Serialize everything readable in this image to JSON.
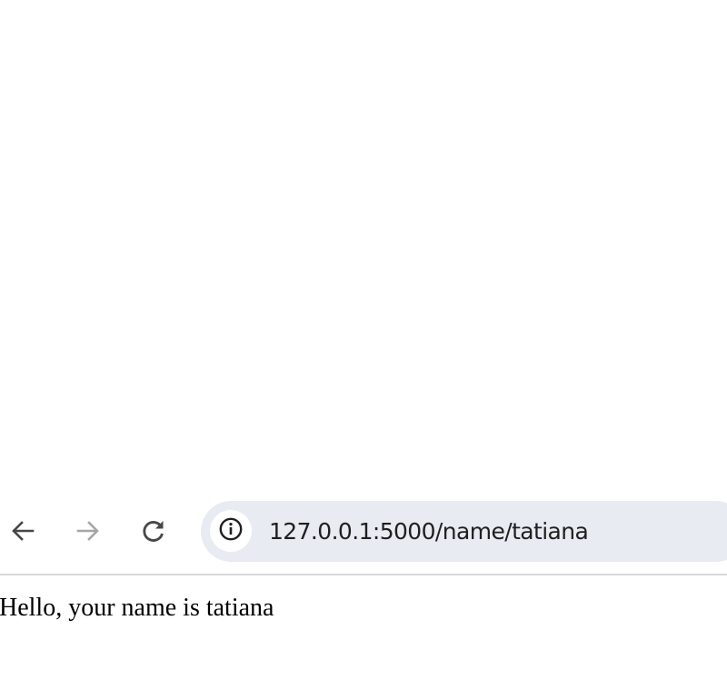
{
  "toolbar": {
    "back_icon": "arrow-left-icon",
    "forward_icon": "arrow-right-icon",
    "reload_icon": "reload-icon",
    "site_info_icon": "info-icon",
    "url": "127.0.0.1:5000/name/tatiana",
    "omnibox_color": "#e8ebf1",
    "forward_enabled": false
  },
  "page": {
    "greeting": "Hello, your name is tatiana"
  }
}
